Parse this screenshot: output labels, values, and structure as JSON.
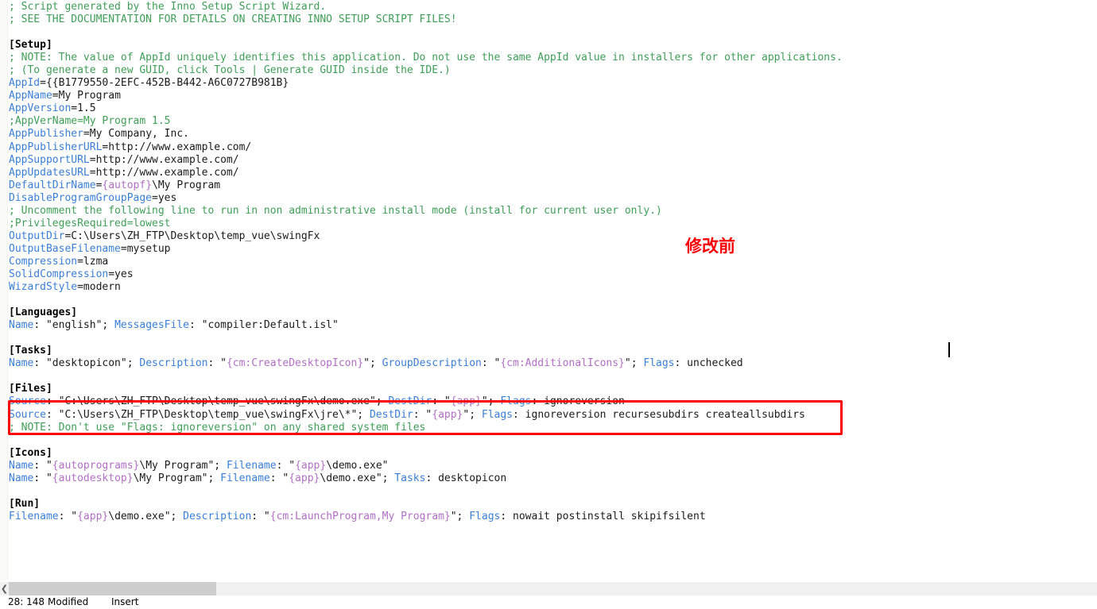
{
  "window": {
    "kind": "text-editor",
    "document_language": "Inno Setup Script"
  },
  "annotations": {
    "chinese_note": "修改前",
    "note_color": "#fb0007",
    "highlight_box_color": "#fb0007"
  },
  "colors": {
    "comment": "#3f9e57",
    "key": "#3a7fd5",
    "constant": "#b26fc4",
    "text": "#1a1a1a",
    "section": "#000000",
    "scrollbar_thumb": "#cdcdcd",
    "gutter": "#fafaf8"
  },
  "scrollbar": {
    "left_arrow_glyph": "❮"
  },
  "status_bar": {
    "position": "28: 148",
    "modified": "Modified",
    "insert_mode": "Insert"
  },
  "code": {
    "lines": [
      {
        "id": "l1",
        "segments": [
          {
            "cls": "cmt",
            "t": "; Script generated by the Inno Setup Script Wizard."
          }
        ]
      },
      {
        "id": "l2",
        "segments": [
          {
            "cls": "cmt",
            "t": "; SEE THE DOCUMENTATION FOR DETAILS ON CREATING INNO SETUP SCRIPT FILES!"
          }
        ]
      },
      {
        "id": "l3",
        "segments": [
          {
            "cls": "txt",
            "t": ""
          }
        ]
      },
      {
        "id": "l4",
        "segments": [
          {
            "cls": "sect",
            "t": "[Setup]"
          }
        ]
      },
      {
        "id": "l5",
        "segments": [
          {
            "cls": "cmt",
            "t": "; NOTE: The value of AppId uniquely identifies this application. Do not use the same AppId value in installers for other applications."
          }
        ]
      },
      {
        "id": "l6",
        "segments": [
          {
            "cls": "cmt",
            "t": "; (To generate a new GUID, click Tools | Generate GUID inside the IDE.)"
          }
        ]
      },
      {
        "id": "l7",
        "segments": [
          {
            "cls": "key",
            "t": "AppId"
          },
          {
            "cls": "txt",
            "t": "={{B1779550-2EFC-452B-B442-A6C0727B981B}"
          }
        ]
      },
      {
        "id": "l8",
        "segments": [
          {
            "cls": "key",
            "t": "AppName"
          },
          {
            "cls": "txt",
            "t": "=My Program"
          }
        ]
      },
      {
        "id": "l9",
        "segments": [
          {
            "cls": "key",
            "t": "AppVersion"
          },
          {
            "cls": "txt",
            "t": "=1.5"
          }
        ]
      },
      {
        "id": "l10",
        "segments": [
          {
            "cls": "cmt",
            "t": ";AppVerName=My Program 1.5"
          }
        ]
      },
      {
        "id": "l11",
        "segments": [
          {
            "cls": "key",
            "t": "AppPublisher"
          },
          {
            "cls": "txt",
            "t": "=My Company, Inc."
          }
        ]
      },
      {
        "id": "l12",
        "segments": [
          {
            "cls": "key",
            "t": "AppPublisherURL"
          },
          {
            "cls": "txt",
            "t": "=http://www.example.com/"
          }
        ]
      },
      {
        "id": "l13",
        "segments": [
          {
            "cls": "key",
            "t": "AppSupportURL"
          },
          {
            "cls": "txt",
            "t": "=http://www.example.com/"
          }
        ]
      },
      {
        "id": "l14",
        "segments": [
          {
            "cls": "key",
            "t": "AppUpdatesURL"
          },
          {
            "cls": "txt",
            "t": "=http://www.example.com/"
          }
        ]
      },
      {
        "id": "l15",
        "segments": [
          {
            "cls": "key",
            "t": "DefaultDirName"
          },
          {
            "cls": "txt",
            "t": "="
          },
          {
            "cls": "const",
            "t": "{autopf}"
          },
          {
            "cls": "txt",
            "t": "\\My Program"
          }
        ]
      },
      {
        "id": "l16",
        "segments": [
          {
            "cls": "key",
            "t": "DisableProgramGroupPage"
          },
          {
            "cls": "txt",
            "t": "=yes"
          }
        ]
      },
      {
        "id": "l17",
        "segments": [
          {
            "cls": "cmt",
            "t": "; Uncomment the following line to run in non administrative install mode (install for current user only.)"
          }
        ]
      },
      {
        "id": "l18",
        "segments": [
          {
            "cls": "cmt",
            "t": ";PrivilegesRequired=lowest"
          }
        ]
      },
      {
        "id": "l19",
        "segments": [
          {
            "cls": "key",
            "t": "OutputDir"
          },
          {
            "cls": "txt",
            "t": "=C:\\Users\\ZH_FTP\\Desktop\\temp_vue\\swingFx"
          }
        ]
      },
      {
        "id": "l20",
        "segments": [
          {
            "cls": "key",
            "t": "OutputBaseFilename"
          },
          {
            "cls": "txt",
            "t": "=mysetup"
          }
        ]
      },
      {
        "id": "l21",
        "segments": [
          {
            "cls": "key",
            "t": "Compression"
          },
          {
            "cls": "txt",
            "t": "=lzma"
          }
        ]
      },
      {
        "id": "l22",
        "segments": [
          {
            "cls": "key",
            "t": "SolidCompression"
          },
          {
            "cls": "txt",
            "t": "=yes"
          }
        ]
      },
      {
        "id": "l23",
        "segments": [
          {
            "cls": "key",
            "t": "WizardStyle"
          },
          {
            "cls": "txt",
            "t": "=modern"
          }
        ]
      },
      {
        "id": "l24",
        "segments": [
          {
            "cls": "txt",
            "t": ""
          }
        ]
      },
      {
        "id": "l25",
        "segments": [
          {
            "cls": "sect",
            "t": "[Languages]"
          }
        ]
      },
      {
        "id": "l26",
        "segments": [
          {
            "cls": "key",
            "t": "Name"
          },
          {
            "cls": "txt",
            "t": ": \"english\"; "
          },
          {
            "cls": "key",
            "t": "MessagesFile"
          },
          {
            "cls": "txt",
            "t": ": \"compiler:Default.isl\""
          }
        ]
      },
      {
        "id": "l27",
        "segments": [
          {
            "cls": "txt",
            "t": ""
          }
        ]
      },
      {
        "id": "l28",
        "segments": [
          {
            "cls": "sect",
            "t": "[Tasks]"
          }
        ]
      },
      {
        "id": "l29",
        "segments": [
          {
            "cls": "key",
            "t": "Name"
          },
          {
            "cls": "txt",
            "t": ": \"desktopicon\"; "
          },
          {
            "cls": "key",
            "t": "Description"
          },
          {
            "cls": "txt",
            "t": ": \""
          },
          {
            "cls": "const",
            "t": "{cm:CreateDesktopIcon}"
          },
          {
            "cls": "txt",
            "t": "\"; "
          },
          {
            "cls": "key",
            "t": "GroupDescription"
          },
          {
            "cls": "txt",
            "t": ": \""
          },
          {
            "cls": "const",
            "t": "{cm:AdditionalIcons}"
          },
          {
            "cls": "txt",
            "t": "\"; "
          },
          {
            "cls": "key",
            "t": "Flags"
          },
          {
            "cls": "txt",
            "t": ": unchecked"
          }
        ]
      },
      {
        "id": "l30",
        "segments": [
          {
            "cls": "txt",
            "t": ""
          }
        ]
      },
      {
        "id": "l31",
        "segments": [
          {
            "cls": "sect",
            "t": "[Files]"
          }
        ]
      },
      {
        "id": "l32",
        "segments": [
          {
            "cls": "key",
            "t": "Source"
          },
          {
            "cls": "txt",
            "t": ": \"C:\\Users\\ZH_FTP\\Desktop\\temp_vue\\swingFx\\demo.exe\"; "
          },
          {
            "cls": "key",
            "t": "DestDir"
          },
          {
            "cls": "txt",
            "t": ": \""
          },
          {
            "cls": "const",
            "t": "{app}"
          },
          {
            "cls": "txt",
            "t": "\"; "
          },
          {
            "cls": "key",
            "t": "Flags"
          },
          {
            "cls": "txt",
            "t": ": ignoreversion"
          }
        ]
      },
      {
        "id": "l33",
        "segments": [
          {
            "cls": "key",
            "t": "Source"
          },
          {
            "cls": "txt",
            "t": ": \"C:\\Users\\ZH_FTP\\Desktop\\temp_vue\\swingFx\\jre\\*\"; "
          },
          {
            "cls": "key",
            "t": "DestDir"
          },
          {
            "cls": "txt",
            "t": ": \""
          },
          {
            "cls": "const",
            "t": "{app}"
          },
          {
            "cls": "txt",
            "t": "\"; "
          },
          {
            "cls": "key",
            "t": "Flags"
          },
          {
            "cls": "txt",
            "t": ": ignoreversion recursesubdirs createallsubdirs"
          }
        ]
      },
      {
        "id": "l34",
        "segments": [
          {
            "cls": "cmt",
            "t": "; NOTE: Don't use \"Flags: ignoreversion\" on any shared system files"
          }
        ]
      },
      {
        "id": "l35",
        "segments": [
          {
            "cls": "txt",
            "t": ""
          }
        ]
      },
      {
        "id": "l36",
        "segments": [
          {
            "cls": "sect",
            "t": "[Icons]"
          }
        ]
      },
      {
        "id": "l37",
        "segments": [
          {
            "cls": "key",
            "t": "Name"
          },
          {
            "cls": "txt",
            "t": ": \""
          },
          {
            "cls": "const",
            "t": "{autoprograms}"
          },
          {
            "cls": "txt",
            "t": "\\My Program\"; "
          },
          {
            "cls": "key",
            "t": "Filename"
          },
          {
            "cls": "txt",
            "t": ": \""
          },
          {
            "cls": "const",
            "t": "{app}"
          },
          {
            "cls": "txt",
            "t": "\\demo.exe\""
          }
        ]
      },
      {
        "id": "l38",
        "segments": [
          {
            "cls": "key",
            "t": "Name"
          },
          {
            "cls": "txt",
            "t": ": \""
          },
          {
            "cls": "const",
            "t": "{autodesktop}"
          },
          {
            "cls": "txt",
            "t": "\\My Program\"; "
          },
          {
            "cls": "key",
            "t": "Filename"
          },
          {
            "cls": "txt",
            "t": ": \""
          },
          {
            "cls": "const",
            "t": "{app}"
          },
          {
            "cls": "txt",
            "t": "\\demo.exe\"; "
          },
          {
            "cls": "key",
            "t": "Tasks"
          },
          {
            "cls": "txt",
            "t": ": desktopicon"
          }
        ]
      },
      {
        "id": "l39",
        "segments": [
          {
            "cls": "txt",
            "t": ""
          }
        ]
      },
      {
        "id": "l40",
        "segments": [
          {
            "cls": "sect",
            "t": "[Run]"
          }
        ]
      },
      {
        "id": "l41",
        "segments": [
          {
            "cls": "key",
            "t": "Filename"
          },
          {
            "cls": "txt",
            "t": ": \""
          },
          {
            "cls": "const",
            "t": "{app}"
          },
          {
            "cls": "txt",
            "t": "\\demo.exe\"; "
          },
          {
            "cls": "key",
            "t": "Description"
          },
          {
            "cls": "txt",
            "t": ": \""
          },
          {
            "cls": "const",
            "t": "{cm:LaunchProgram,My Program}"
          },
          {
            "cls": "txt",
            "t": "\"; "
          },
          {
            "cls": "key",
            "t": "Flags"
          },
          {
            "cls": "txt",
            "t": ": nowait postinstall skipifsilent"
          }
        ]
      }
    ]
  }
}
